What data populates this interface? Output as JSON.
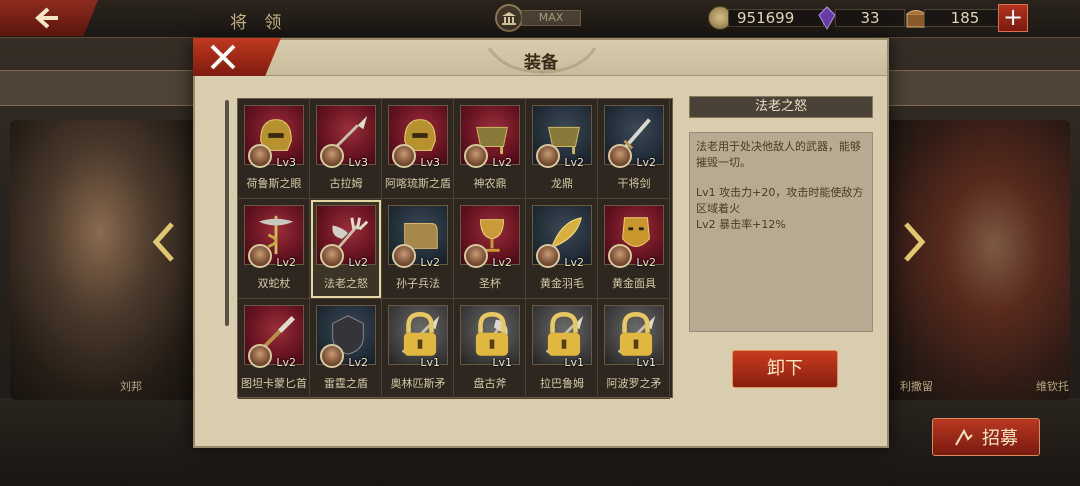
{
  "top_bar": {
    "title": "将 领",
    "building_level": "MAX",
    "coins": "951699",
    "gems": "33",
    "tokens": "185"
  },
  "background": {
    "left_hero_name": "刘邦",
    "right_hero_name": "维钦托",
    "right_hero_partial_name": "利撒留",
    "recruit_label": "招募"
  },
  "modal": {
    "title": "装备",
    "items": [
      {
        "name": "荷鲁斯之眼",
        "level": "Lv3",
        "bg": "red",
        "icon": "helmet-icon",
        "locked": false
      },
      {
        "name": "古拉姆",
        "level": "Lv3",
        "bg": "red",
        "icon": "spear-icon",
        "locked": false
      },
      {
        "name": "阿喀琉斯之盾",
        "level": "Lv3",
        "bg": "red",
        "icon": "helmet-icon",
        "locked": false
      },
      {
        "name": "神农鼎",
        "level": "Lv2",
        "bg": "red",
        "icon": "cauldron-icon",
        "locked": false
      },
      {
        "name": "龙鼎",
        "level": "Lv2",
        "bg": "dark",
        "icon": "cauldron-icon",
        "locked": false
      },
      {
        "name": "干将剑",
        "level": "Lv2",
        "bg": "dark",
        "icon": "sword-icon",
        "locked": false
      },
      {
        "name": "双蛇杖",
        "level": "Lv2",
        "bg": "red",
        "icon": "caduceus-icon",
        "locked": false
      },
      {
        "name": "法老之怒",
        "level": "Lv2",
        "bg": "red",
        "icon": "trident-axe-icon",
        "locked": false
      },
      {
        "name": "孙子兵法",
        "level": "Lv2",
        "bg": "dark",
        "icon": "scroll-icon",
        "locked": false
      },
      {
        "name": "圣杯",
        "level": "Lv2",
        "bg": "red",
        "icon": "chalice-icon",
        "locked": false
      },
      {
        "name": "黄金羽毛",
        "level": "Lv2",
        "bg": "dark",
        "icon": "feather-icon",
        "locked": false
      },
      {
        "name": "黄金面具",
        "level": "Lv2",
        "bg": "red",
        "icon": "mask-icon",
        "locked": false
      },
      {
        "name": "图坦卡蒙匕首",
        "level": "Lv2",
        "bg": "red",
        "icon": "dagger-icon",
        "locked": false
      },
      {
        "name": "雷霆之盾",
        "level": "Lv2",
        "bg": "dark",
        "icon": "shield-icon",
        "locked": false
      },
      {
        "name": "奥林匹斯矛",
        "level": "Lv1",
        "bg": "grey",
        "icon": "spear-icon",
        "locked": true
      },
      {
        "name": "盘古斧",
        "level": "Lv1",
        "bg": "grey",
        "icon": "axe-icon",
        "locked": true
      },
      {
        "name": "拉巴鲁姆",
        "level": "Lv1",
        "bg": "grey",
        "icon": "spear-icon",
        "locked": true
      },
      {
        "name": "阿波罗之矛",
        "level": "Lv1",
        "bg": "grey",
        "icon": "spear-icon",
        "locked": true
      }
    ],
    "detail": {
      "title": "法老之怒",
      "description": "法老用于处决他敌人的武器，能够摧毁一切。",
      "effects": [
        "Lv1  攻击力+20，攻击时能使敌方区域着火",
        "Lv2  暴击率+12%"
      ]
    },
    "unequip_label": "卸下"
  },
  "colors": {
    "accent_red": "#b8351d",
    "panel": "#d9cdb0",
    "gold": "#c9b48a"
  }
}
